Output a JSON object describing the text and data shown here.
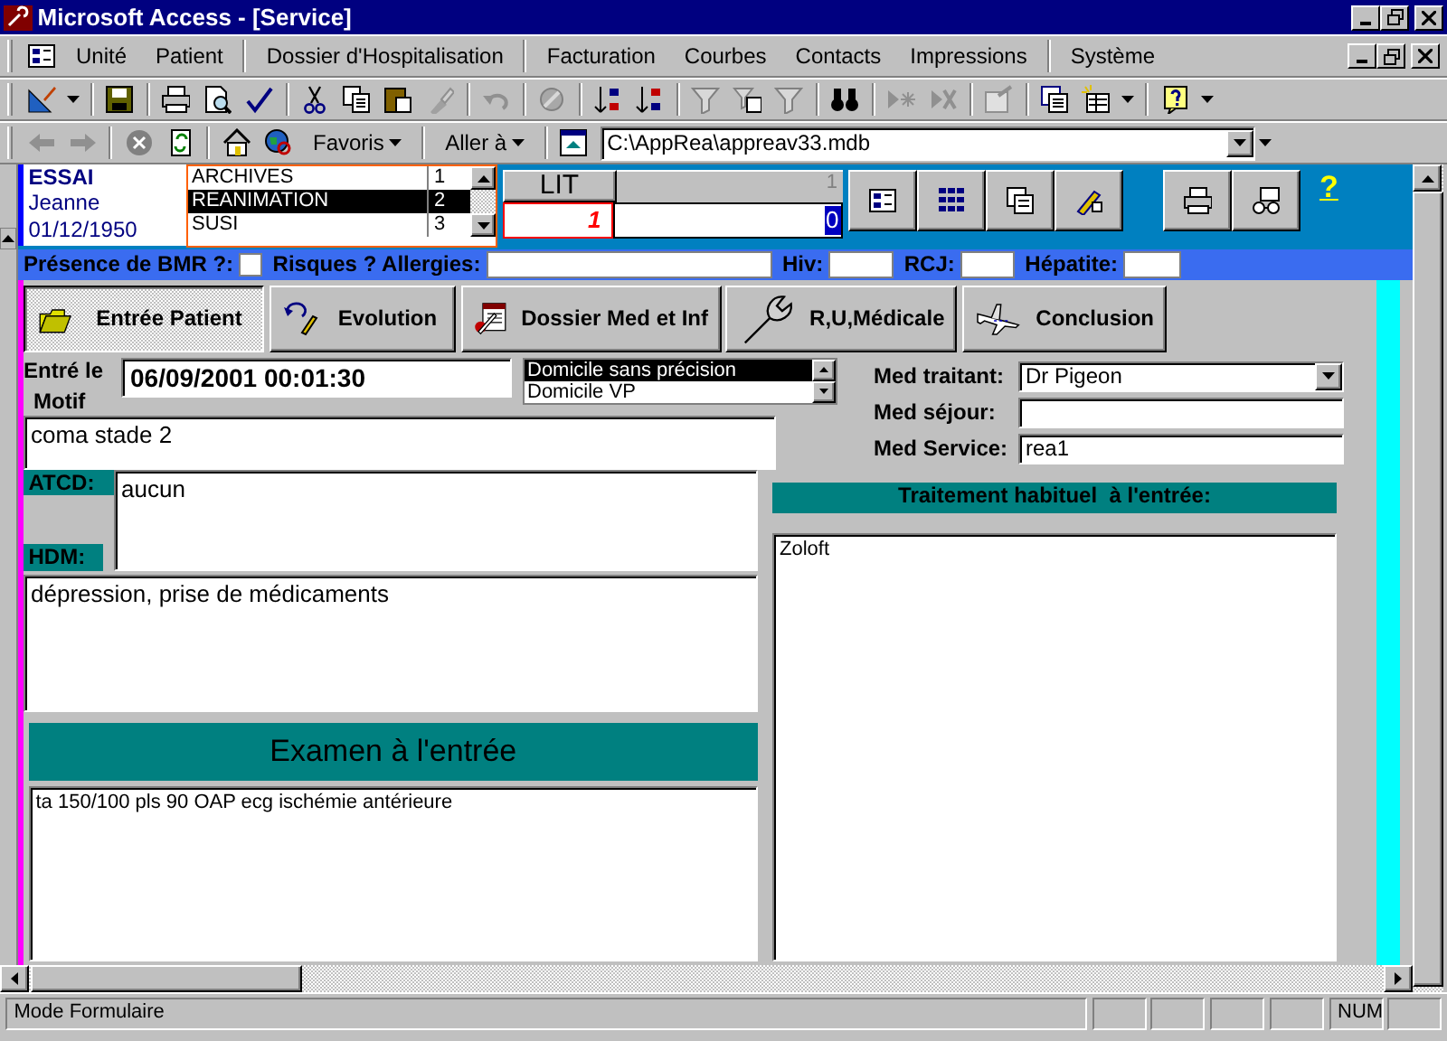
{
  "title_bar": {
    "title": "Microsoft Access - [Service]"
  },
  "menu_bar": {
    "items": [
      "Unité",
      "Patient",
      "Dossier d'Hospitalisation",
      "Facturation",
      "Courbes",
      "Contacts",
      "Impressions",
      "Système"
    ]
  },
  "web_toolbar": {
    "favorites": "Favoris",
    "go_to": "Aller à",
    "address": "C:\\AppRea\\appreav33.mdb"
  },
  "patient": {
    "last_name": "ESSAI",
    "first_name": "Jeanne",
    "birth_date": "01/12/1950"
  },
  "services": [
    {
      "name": "ARCHIVES",
      "number": "1",
      "selected": false
    },
    {
      "name": "REANIMATION",
      "number": "2",
      "selected": true
    },
    {
      "name": "SUSI",
      "number": "3",
      "selected": false
    }
  ],
  "bed": {
    "label": "LIT",
    "count": "1",
    "number": "1",
    "value": "0"
  },
  "help": "?",
  "flags": {
    "bmr_label": "Présence de BMR ?:",
    "bmr_checked": false,
    "allergies_label": "Risques ? Allergies:",
    "hiv_label": "Hiv:",
    "rcj_label": "RCJ:",
    "hepatitis_label": "Hépatite:"
  },
  "tabs": [
    {
      "label": "Entrée Patient",
      "selected": true
    },
    {
      "label": "Evolution",
      "selected": false
    },
    {
      "label": "Dossier Med et Inf",
      "selected": false
    },
    {
      "label": "R,U,Médicale",
      "selected": false
    },
    {
      "label": "Conclusion",
      "selected": false
    }
  ],
  "entry": {
    "entered_label": "Entré le",
    "motif_label": "Motif",
    "date": "06/09/2001 00:01:30",
    "origins": [
      {
        "label": "Domicile sans précision",
        "selected": true
      },
      {
        "label": "Domicile VP",
        "selected": false
      }
    ],
    "motif": "coma stade 2"
  },
  "doctors": [
    {
      "label": "Med traitant:",
      "value": "Dr Pigeon",
      "kind": "combo"
    },
    {
      "label": "Med séjour:",
      "kind": "text"
    },
    {
      "label": "Med Service:",
      "value": "rea1",
      "kind": "text"
    }
  ],
  "atcd": {
    "label": "ATCD:",
    "value": "aucun"
  },
  "hdm": {
    "label": "HDM:",
    "value": "dépression, prise de médicaments"
  },
  "treatment": {
    "title": "Traitement habituel  à l'entrée:",
    "value": "Zoloft"
  },
  "exam": {
    "title": "Examen à l'entrée",
    "value": "ta 150/100 pls 90 OAP ecg ischémie antérieure"
  },
  "status_bar": {
    "mode": "Mode Formulaire",
    "num": "NUM"
  }
}
